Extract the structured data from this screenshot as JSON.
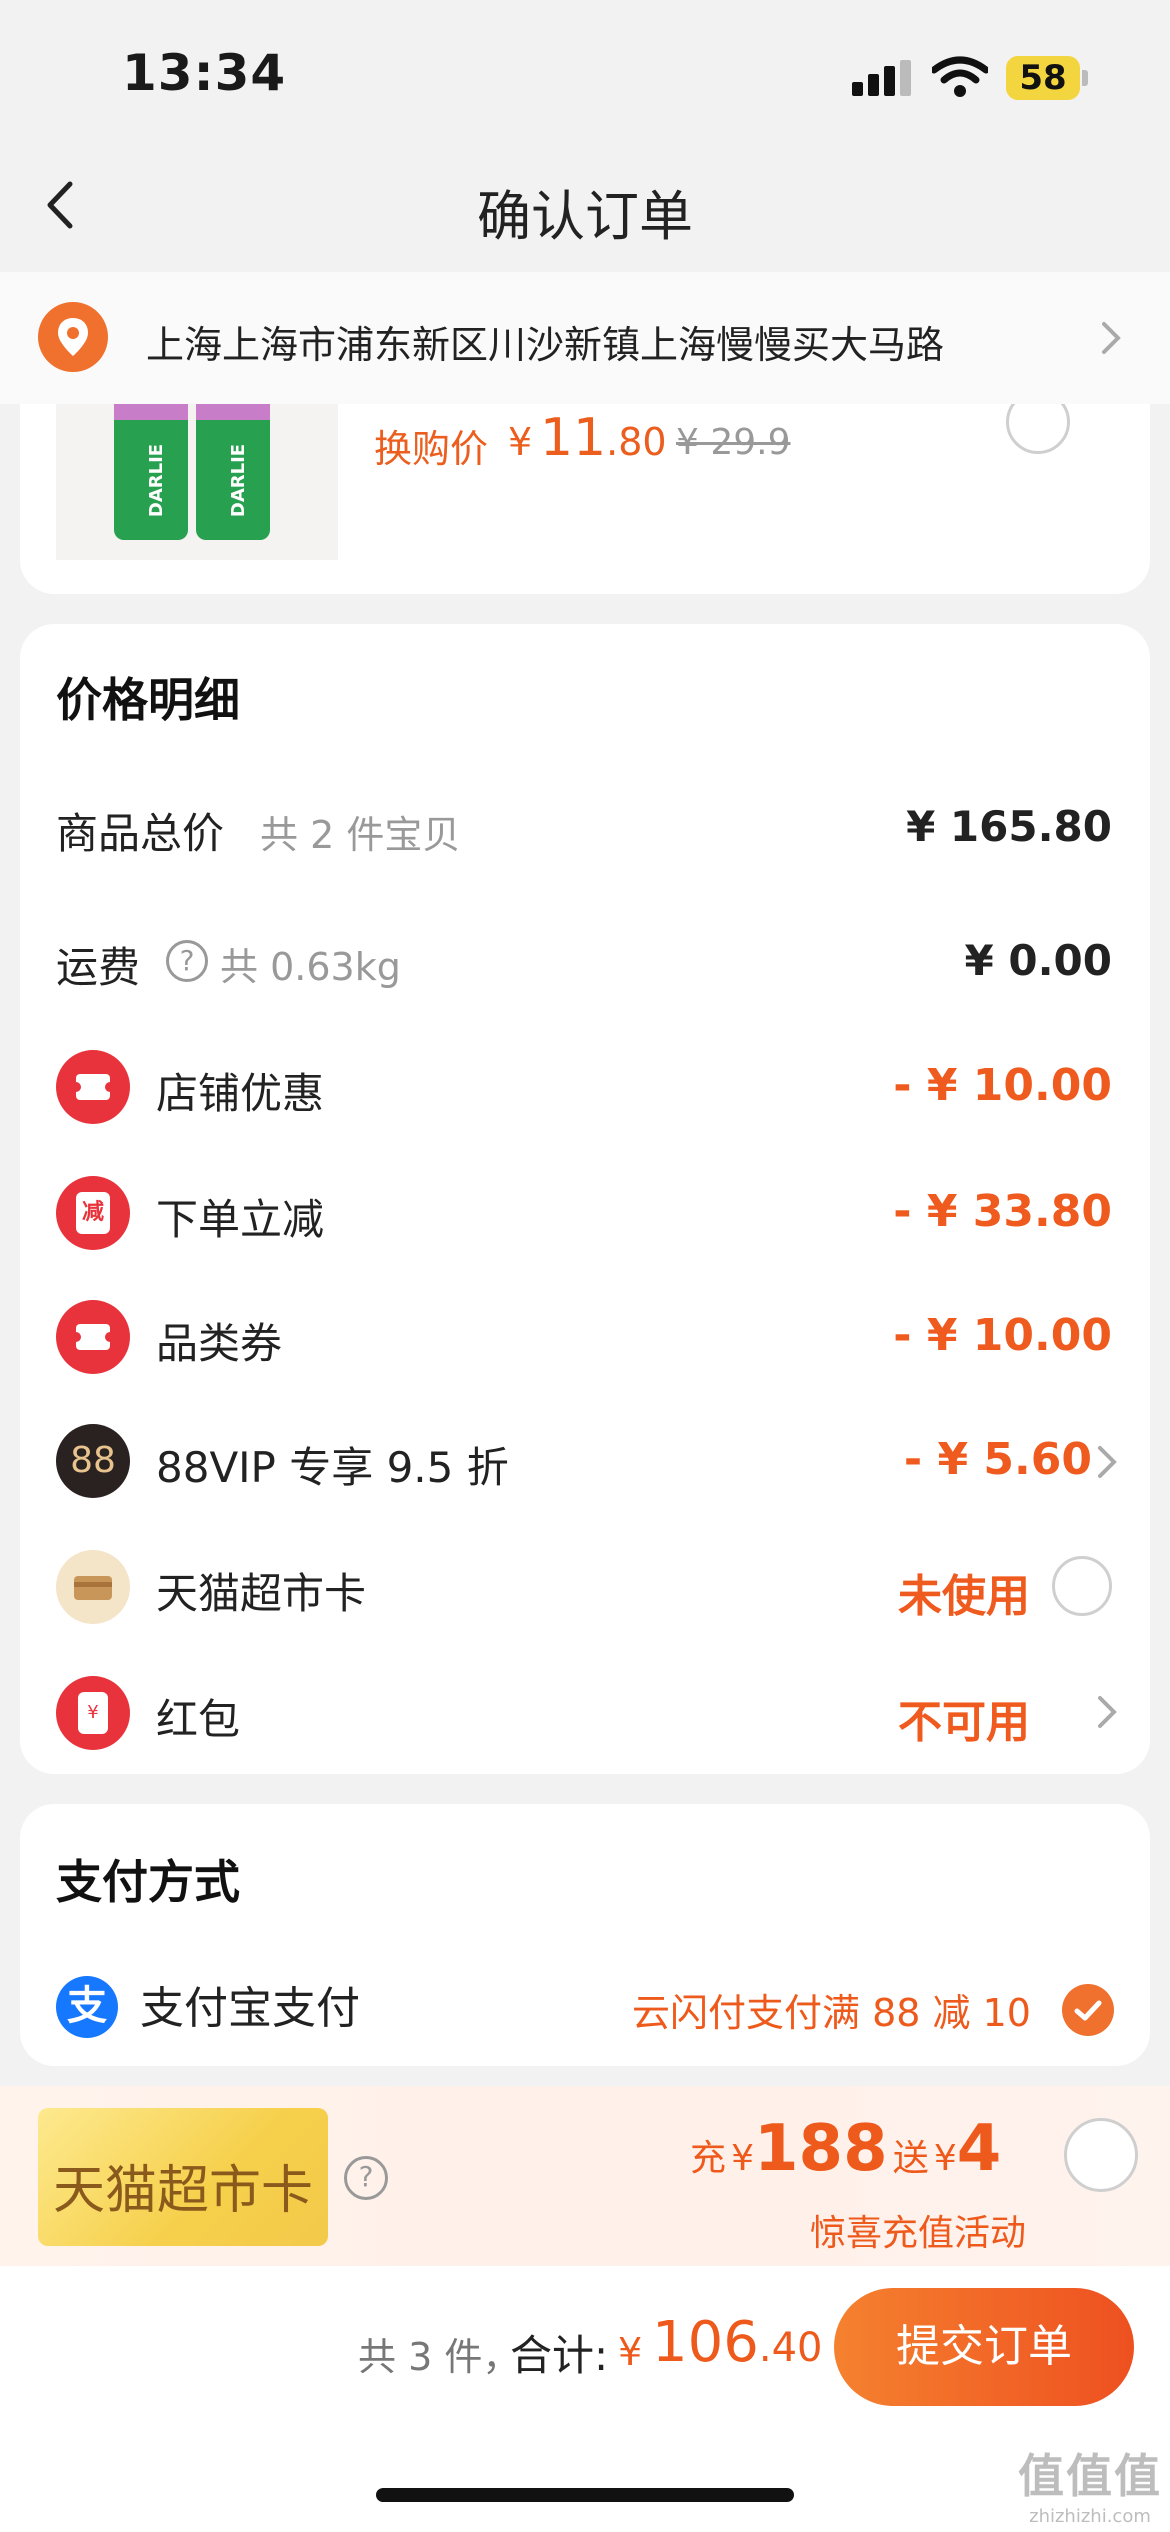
{
  "status_bar": {
    "time": "13:34",
    "battery": "58"
  },
  "nav": {
    "title": "确认订单",
    "back_icon": "chevron-left-icon"
  },
  "address": {
    "text": "上海上海市浦东新区川沙新镇上海慢慢买大马路",
    "icon": "location-pin-icon"
  },
  "product": {
    "exchange_label": "换购价",
    "yen": "¥",
    "price_int": "11",
    "price_dec": ".80",
    "original_price": "¥ 29.9",
    "brand_text": "DARLIE"
  },
  "price_detail": {
    "title": "价格明细",
    "subtotal": {
      "label": "商品总价",
      "sub": "共 2 件宝贝",
      "value": "¥ 165.80"
    },
    "shipping": {
      "label": "运费",
      "sub": "共 0.63kg",
      "value": "¥ 0.00"
    },
    "discounts": [
      {
        "label": "店铺优惠",
        "value": "- ¥ 10.00",
        "icon": "ticket-icon"
      },
      {
        "label": "下单立减",
        "value": "- ¥ 33.80",
        "icon": "instant-discount-icon",
        "icon_char": "减"
      },
      {
        "label": "品类券",
        "value": "- ¥ 10.00",
        "icon": "ticket-icon"
      },
      {
        "label": "88VIP 专享 9.5 折",
        "value": "- ¥ 5.60",
        "icon": "88vip-icon",
        "icon_char": "88"
      },
      {
        "label": "天猫超市卡",
        "value": "未使用",
        "icon": "card-icon"
      },
      {
        "label": "红包",
        "value": "不可用",
        "icon": "red-packet-icon",
        "icon_char": "¥"
      }
    ]
  },
  "payment": {
    "title": "支付方式",
    "method": "支付宝支付",
    "icon_char": "支",
    "promo": "云闪付支付满 88 减 10"
  },
  "card_promo": {
    "card_text": "天猫超市卡",
    "charge_label": "充",
    "yen": "¥",
    "charge_amount": "188",
    "gift_label": "送",
    "gift_amount": "4",
    "subtitle": "惊喜充值活动"
  },
  "footer": {
    "count": "共 3 件，",
    "total_label": "合计:",
    "yen": "¥",
    "total_int": "106",
    "total_dec": ".40",
    "submit": "提交订单"
  },
  "watermark": {
    "big": "值值值",
    "small": "zhizhizhi.com"
  },
  "colors": {
    "accent": "#ee5a1c",
    "badge_red": "#e9333c",
    "vip_dark": "#2a2220",
    "alipay": "#1677ff"
  }
}
